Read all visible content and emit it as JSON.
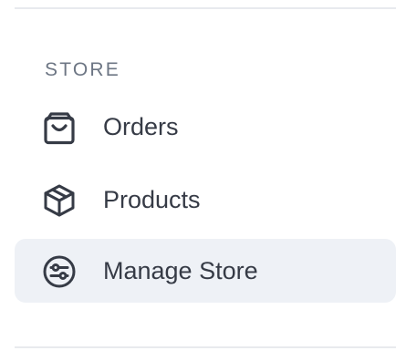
{
  "sidebar": {
    "section_label": "STORE",
    "items": [
      {
        "label": "Orders",
        "icon": "shopping-bag-icon",
        "active": false
      },
      {
        "label": "Products",
        "icon": "box-icon",
        "active": false
      },
      {
        "label": "Manage Store",
        "icon": "sliders-icon",
        "active": true
      }
    ]
  },
  "colors": {
    "active_background": "#eef1f6",
    "text": "#363b46",
    "section_label": "#6d7684",
    "divider": "#e8eaee"
  }
}
